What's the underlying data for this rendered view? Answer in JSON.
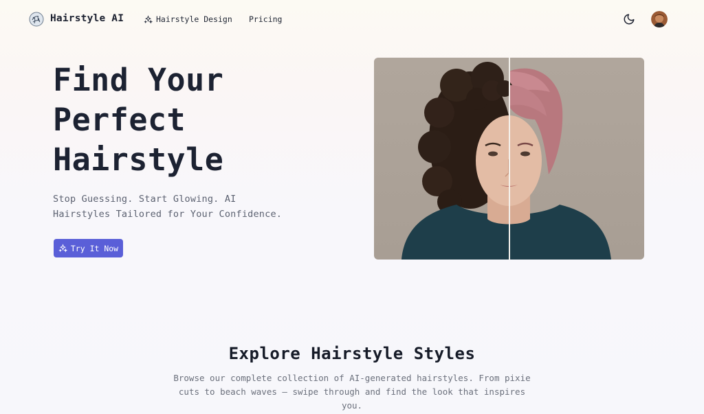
{
  "nav": {
    "brand": "Hairstyle AI",
    "logo_icon": "brain-circuit-icon",
    "links": [
      {
        "label": "Hairstyle Design",
        "icon": "sparkles-icon"
      },
      {
        "label": "Pricing"
      }
    ],
    "theme_icon": "moon-icon",
    "avatar_icon": "user-avatar"
  },
  "hero": {
    "title": "Find Your Perfect Hairstyle",
    "subtitle": "Stop Guessing. Start Glowing. AI Hairstyles Tailored for Your Confidence.",
    "cta_label": "Try It Now",
    "cta_icon": "sparkles-icon",
    "accent": "#5a5fd8"
  },
  "explore": {
    "title": "Explore Hairstyle Styles",
    "description": "Browse our complete collection of AI-generated hairstyles. From pixie cuts to beach waves — swipe through and find the look that inspires you."
  }
}
